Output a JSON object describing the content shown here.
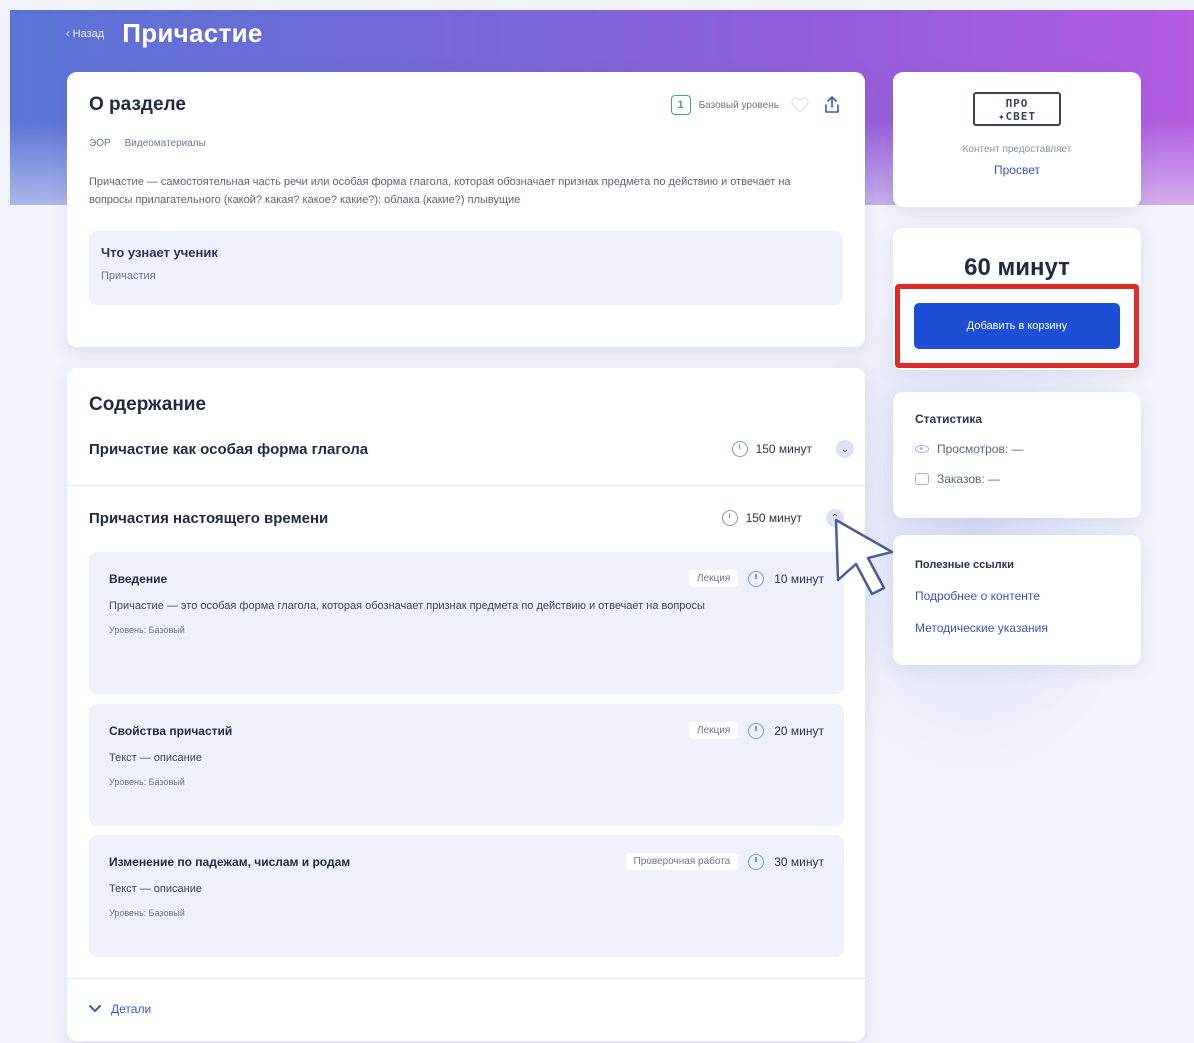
{
  "header": {
    "back_label": "Назад",
    "title": "Причастие"
  },
  "about": {
    "title": "О разделе",
    "level_number": "1",
    "level_label": "Базовый уровень",
    "tags": [
      "ЭОР",
      "Видеоматериалы"
    ],
    "description": "Причастие — самостоятельная часть речи или особая форма глагола, которая обозначает признак предмета по действию и отвечает на вопросы прилагательного (какой? какая? какое? какие?): облака (какие?) плывущие",
    "learn": {
      "title": "Что узнает ученик",
      "item": "Причастия"
    }
  },
  "content": {
    "title": "Содержание",
    "sections": [
      {
        "name": "Причастие как особая форма глагола",
        "duration": "150 минут",
        "chevron": "⌄"
      },
      {
        "name": "Причастия настоящего времени",
        "duration": "150 минут",
        "chevron": "⌃"
      }
    ],
    "lessons": [
      {
        "name": "Введение",
        "type": "Лекция",
        "duration": "10 минут",
        "desc": "Причастие — это особая форма глагола, которая обозначает признак предмета по действию и отвечает на вопросы",
        "level": "Уровень: Базовый"
      },
      {
        "name": "Свойства причастий",
        "type": "Лекция",
        "duration": "20 минут",
        "desc": "Текст — описание",
        "level": "Уровень: Базовый"
      },
      {
        "name": "Изменение по падежам, числам и родам",
        "type": "Проверочная работа",
        "duration": "30 минут",
        "desc": "Текст — описание",
        "level": "Уровень: Базовый"
      }
    ],
    "details_label": "Детали"
  },
  "provider": {
    "logo_top": "ПРО",
    "logo_bottom": "✦СВЕТ",
    "caption": "Контент предоставляет",
    "name": "Просвет"
  },
  "price": {
    "value": "60 минут",
    "add_to_cart": "Добавить в корзину"
  },
  "stats": {
    "title": "Статистика",
    "views": "Просмотров: —",
    "orders": "Заказов: —"
  },
  "links": {
    "title": "Полезные ссылки",
    "items": [
      "Подробнее о контенте",
      "Методические указания"
    ]
  },
  "colors": {
    "accent": "#1c4fd6",
    "highlight_frame": "#e02a2a",
    "level_green": "#3cae6a"
  }
}
